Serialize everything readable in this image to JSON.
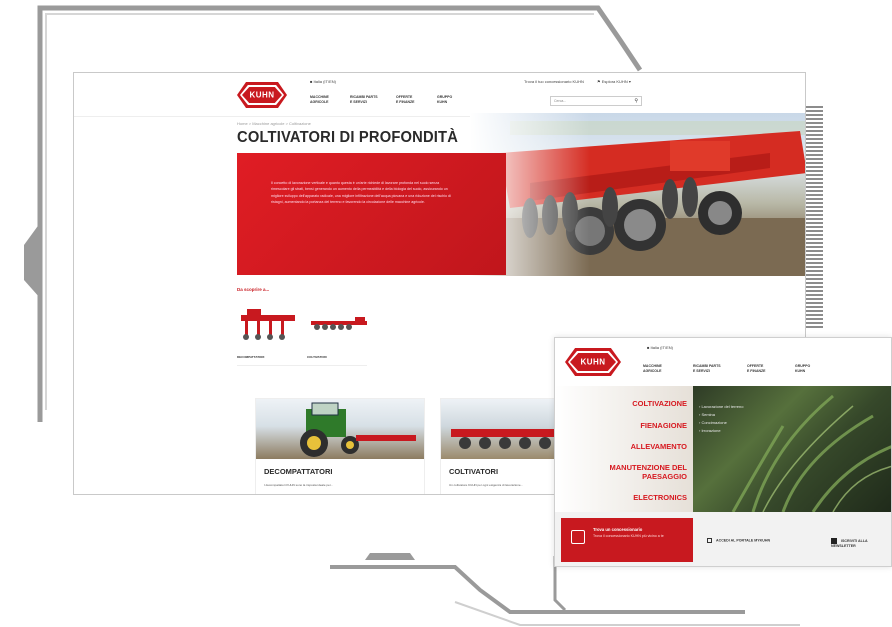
{
  "main": {
    "logo_text": "KUHN",
    "language_selector": "■ Italia (IT/EN)",
    "topbar_link": "Trova il tuo concessionario KUHN",
    "login": "⚑ Esplora KUHN ▾",
    "nav": [
      {
        "line1": "MACCHINE",
        "line2": "AGRICOLE"
      },
      {
        "line1": "RICAMBI PARTS",
        "line2": "E SERVIZI"
      },
      {
        "line1": "OFFERTE",
        "line2": "E FINANZE"
      },
      {
        "line1": "GRUPPO",
        "line2": "KUHN"
      }
    ],
    "search_placeholder": "Cerca...",
    "search_icon": "🔍",
    "breadcrumb": "Home > Macchine agricole > Coltivazione",
    "page_title": "COLTIVATORI DI PROFONDITÀ",
    "intro_text": "Il concetto di lavorazione verticale e quanto questa è un'arte richiede di lavorare profonda nel suolo senza rimescolare gli strati, bensì generando un aumento della permeabilità e della biologia del suolo, assicurando un migliore sviluppo dell'apparato radicale, una migliore infiltrazione dell'acqua piovana e una riduzione del rischio di ristagni, aumentando la portanza del terreno e favorendo la circolazione delle macchine agricole.",
    "discover_label": "Da scoprire a...",
    "products": [
      {
        "label": "DECOMPATTATORI"
      },
      {
        "label": "COLTIVATORI"
      }
    ],
    "cards": [
      {
        "title": "DECOMPATTATORI",
        "desc": "I decompattatori KUHN sono la risposta ideale per..."
      },
      {
        "title": "COLTIVATORI",
        "desc": "Un coltivatore KUHN per ogni esigenza di lavorazione..."
      }
    ]
  },
  "overlay": {
    "language_selector": "■ Italia (IT/EN)",
    "nav": [
      {
        "line1": "MACCHINE",
        "line2": "AGRICOLE"
      },
      {
        "line1": "RICAMBI PARTS",
        "line2": "E SERVIZI"
      },
      {
        "line1": "OFFERTE",
        "line2": "E FINANZE"
      },
      {
        "line1": "GRUPPO",
        "line2": "KUHN"
      }
    ],
    "menu": [
      "COLTIVAZIONE",
      "FIENAGIONE",
      "ALLEVAMENTO",
      "MANUTENZIONE DEL",
      "PAESAGGIO",
      "ELECTRONICS"
    ],
    "submenu": [
      "› Lavorazione del terreno",
      "› Semina",
      "› Concimazione",
      "› Irrorazione"
    ],
    "dealer_title": "Trova un concessionario",
    "dealer_text": "Trova il concessionario KUHN più vicino a te",
    "link1": "ACCEDI AL PORTALE MYKUHN",
    "link2": "ISCRIVITI ALLA NEWSLETTER"
  },
  "colors": {
    "brand_red": "#c8191f",
    "frame_gray": "#8c8c8c"
  }
}
